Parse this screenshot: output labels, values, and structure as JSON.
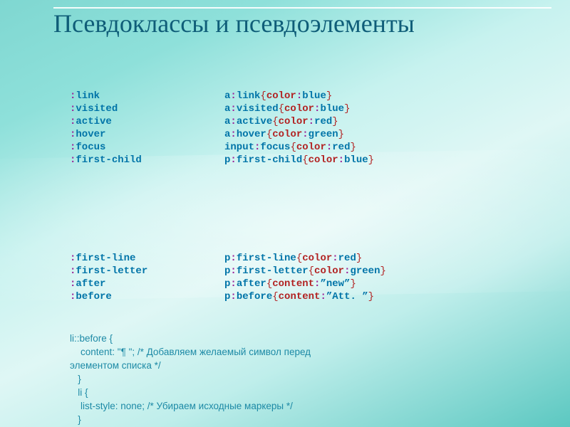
{
  "title": "Псевдоклассы и псевдоэлементы",
  "block1": {
    "pseudos": [
      "link",
      "visited",
      "active",
      "hover",
      "focus",
      "first-child"
    ],
    "examples": [
      {
        "sel": "a",
        "pseudo": "link",
        "prop": "color",
        "val": "blue",
        "type": "ident"
      },
      {
        "sel": "a",
        "pseudo": "visited",
        "prop": "color",
        "val": "blue",
        "type": "ident"
      },
      {
        "sel": "a",
        "pseudo": "active",
        "prop": "color",
        "val": "red",
        "type": "ident"
      },
      {
        "sel": "a",
        "pseudo": "hover",
        "prop": "color",
        "val": "green",
        "type": "ident"
      },
      {
        "sel": "input",
        "pseudo": "focus",
        "prop": "color",
        "val": "red",
        "type": "ident"
      },
      {
        "sel": "p",
        "pseudo": "first-child",
        "prop": "color",
        "val": "blue",
        "type": "ident"
      }
    ]
  },
  "block2": {
    "pseudos": [
      "first-line",
      "first-letter",
      "after",
      "before"
    ],
    "examples": [
      {
        "sel": "p",
        "pseudo": "first-line",
        "prop": "color",
        "val": "red",
        "type": "ident"
      },
      {
        "sel": "p",
        "pseudo": "first-letter",
        "prop": "color",
        "val": "green",
        "type": "ident"
      },
      {
        "sel": "p",
        "pseudo": "after",
        "prop": "content",
        "val": "”new”",
        "type": "string"
      },
      {
        "sel": "p",
        "pseudo": "before",
        "prop": "content",
        "val": "”Att. ”",
        "type": "string"
      }
    ]
  },
  "extra": {
    "l1": "li::before {",
    "l2": "    content: \"¶ \"; /* Добавляем желаемый символ перед",
    "l3": "элементом списка */",
    "l4": "   }",
    "l5": "   li {",
    "l6": "    list-style: none; /* Убираем исходные маркеры */",
    "l7": "   }"
  }
}
